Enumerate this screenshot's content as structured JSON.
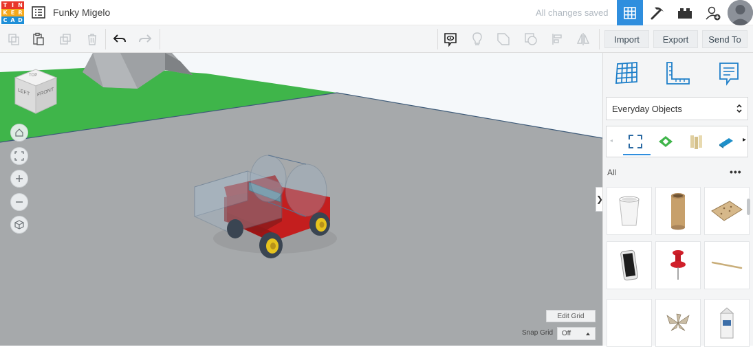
{
  "app": {
    "logo_letters": [
      "T",
      "I",
      "N",
      "K",
      "E",
      "R",
      "C",
      "A",
      "D"
    ],
    "logo_colors": [
      "#e8352a",
      "#e8352a",
      "#e8352a",
      "#f6a81b",
      "#f6a81b",
      "#f6a81b",
      "#1f8fd8",
      "#1f8fd8",
      "#1f8fd8"
    ],
    "project_title": "Funky Migelo",
    "save_status": "All changes saved",
    "accent_color": "#2f8ede"
  },
  "header_icons": [
    "design-list-icon",
    "3d-design-view-icon",
    "blocks-tool-icon",
    "bricks-icon",
    "invite-user-icon",
    "user-avatar"
  ],
  "toolbar": {
    "tools": [
      "copy-icon",
      "paste-icon",
      "duplicate-icon",
      "delete-icon",
      "undo-icon",
      "redo-icon",
      "notes-icon",
      "light-bulb-icon",
      "shape-group-icon",
      "shape-hole-icon",
      "align-icon",
      "mirror-icon"
    ],
    "import_label": "Import",
    "export_label": "Export",
    "send_to_label": "Send To"
  },
  "viewport": {
    "view_cube": {
      "top": "TOP",
      "left": "LEFT",
      "front": "FRONT"
    },
    "nav_buttons": [
      "home-view-icon",
      "fit-view-icon",
      "zoom-in-icon",
      "zoom-out-icon",
      "perspective-icon"
    ],
    "edit_grid_label": "Edit Grid",
    "snap_grid_label": "Snap Grid",
    "snap_grid_value": "Off"
  },
  "panel": {
    "top_tools": [
      "workplane-icon",
      "ruler-icon",
      "notes-tool-icon"
    ],
    "library_select": "Everyday Objects",
    "category_label": "All",
    "more_label": "•••",
    "collapse_label": "❯",
    "shapes": [
      "paper-cup",
      "cardboard-tube",
      "cork-board",
      "smartphone",
      "push-pin",
      "skewer-stick",
      "paper-ornament",
      "milk-carton"
    ]
  }
}
